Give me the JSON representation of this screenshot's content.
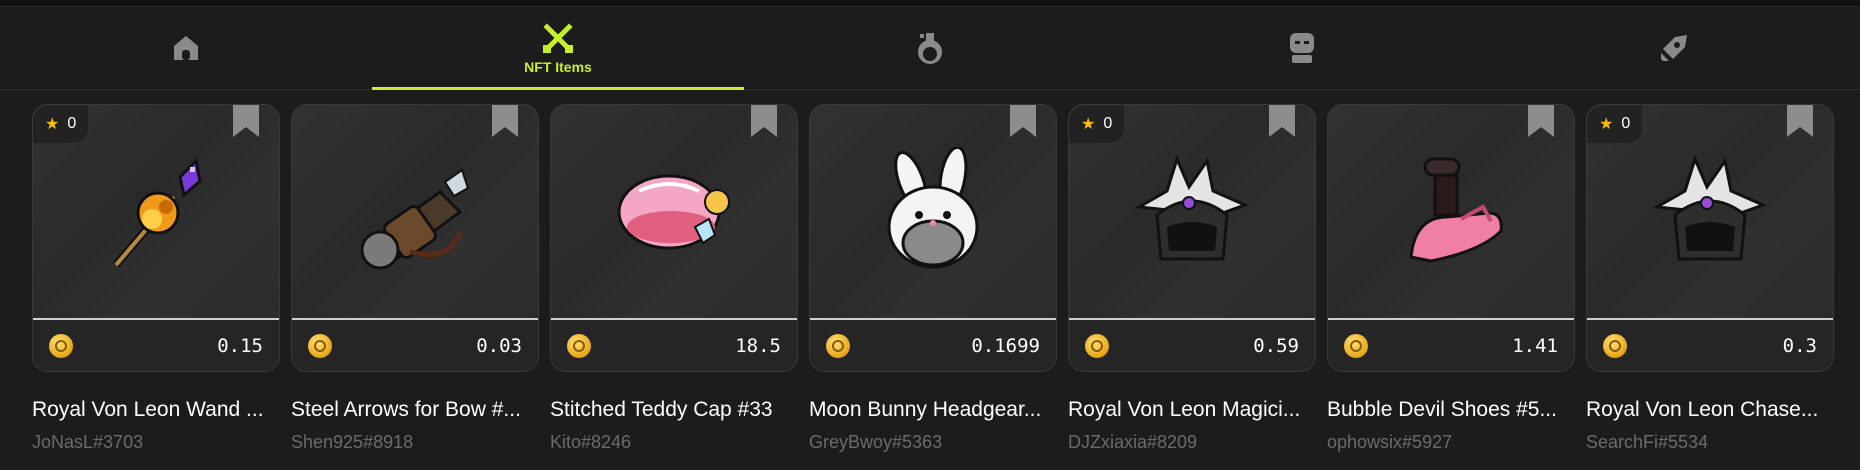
{
  "nav": {
    "tabs": [
      {
        "id": "home",
        "label": "",
        "icon": "home-icon",
        "active": false
      },
      {
        "id": "nft-items",
        "label": "NFT Items",
        "icon": "crossed-swords-icon",
        "active": true
      },
      {
        "id": "potions",
        "label": "",
        "icon": "potion-icon",
        "active": false
      },
      {
        "id": "characters",
        "label": "",
        "icon": "character-icon",
        "active": false
      },
      {
        "id": "other",
        "label": "",
        "icon": "rocket-icon",
        "active": false
      }
    ],
    "accent_color": "#c6ef2a"
  },
  "items": [
    {
      "name": "Royal Von Leon Wand ...",
      "owner": "JoNasL#3703",
      "price": "0.15",
      "favorites": "0",
      "has_favorites": true,
      "art": "wand"
    },
    {
      "name": "Steel Arrows for Bow #...",
      "owner": "Shen925#8918",
      "price": "0.03",
      "favorites": "",
      "has_favorites": false,
      "art": "arrows"
    },
    {
      "name": "Stitched Teddy Cap #33",
      "owner": "Kito#8246",
      "price": "18.5",
      "favorites": "",
      "has_favorites": false,
      "art": "cap"
    },
    {
      "name": "Moon Bunny Headgear...",
      "owner": "GreyBwoy#5363",
      "price": "0.1699",
      "favorites": "",
      "has_favorites": false,
      "art": "bunny"
    },
    {
      "name": "Royal Von Leon Magici...",
      "owner": "DJZxiaxia#8209",
      "price": "0.59",
      "favorites": "0",
      "has_favorites": true,
      "art": "helm"
    },
    {
      "name": "Bubble Devil Shoes #5...",
      "owner": "ophowsix#5927",
      "price": "1.41",
      "favorites": "",
      "has_favorites": false,
      "art": "shoes"
    },
    {
      "name": "Royal Von Leon Chase...",
      "owner": "SearchFi#5534",
      "price": "0.3",
      "favorites": "0",
      "has_favorites": true,
      "art": "helm"
    }
  ]
}
